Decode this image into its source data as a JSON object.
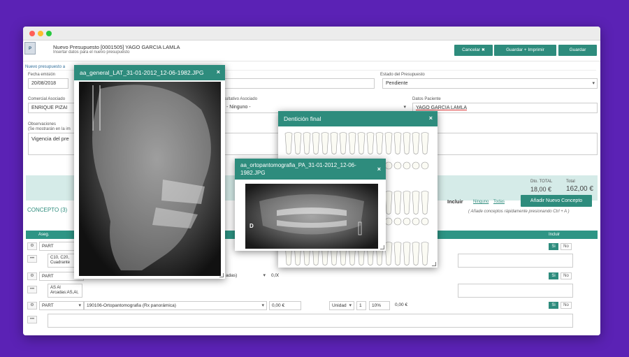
{
  "header": {
    "title": "Nuevo Presupuesto [0001505] YAGO GARCIA LAMLA",
    "subtitle": "Insertar datos para el nuevo presupuesto",
    "logo": "P",
    "cancel_label": "Cancelar",
    "cancel_icon": "✖",
    "save_print_label": "Guardar + Imprimir",
    "save_label": "Guardar"
  },
  "form": {
    "breadcrumb": "Nuevo presupuesto a",
    "fecha_label": "Fecha emisión",
    "fecha_value": "20/08/2018",
    "estado_label": "Estado del Presupuesto",
    "estado_value": "Pendiente",
    "comercial_label": "Comercial Asociado",
    "comercial_value": "ENRIQUE PIZAI",
    "facultativo_label": "cultativo Asociado",
    "facultativo_value": "- Ninguno -",
    "paciente_label": "Datos Paciente",
    "paciente_value": "YAGO GARCIA LAMLA",
    "obs_label": "Observaciones",
    "obs_sub": "(Se mostrarán en la im",
    "obs_value": "Vigencia del pre"
  },
  "totals": {
    "dto_label": "Dto. TOTAL",
    "dto_value": "18,00 €",
    "total_label": "Total",
    "total_value": "162,00 €"
  },
  "concepts": {
    "title": "CONCEPTO (3)",
    "incluir_label": "Incluir",
    "ninguno": "Ninguno",
    "todas": "Todas",
    "add_label": "Añadir Nuevo Concepto",
    "hint": "( Añade conceptos rápidamente presionando Ctrl + A )",
    "col_aseg": "Aseg.",
    "col_incluir": "Incluir",
    "rows": [
      {
        "type": "PART",
        "concept": "",
        "price": "",
        "notes": "C10, C20,\nCuadrante",
        "si": "Si",
        "no": "No"
      },
      {
        "type": "PART",
        "concept": "adas)",
        "price": "0,00",
        "notes": "AS Al\nArcadas:AS,Al,",
        "si": "Si",
        "no": "No"
      },
      {
        "type": "PART",
        "concept": "190106-Ortopantomografia (Rx panorámica)",
        "price": "0,00 €",
        "unit": "Unidad",
        "qty": "1",
        "dto": "10%",
        "total": "0,00 €",
        "notes": "",
        "si": "Si",
        "no": "No"
      }
    ]
  },
  "modals": {
    "lat": {
      "title": "aa_general_LAT_31-01-2012_12-06-1982.JPG",
      "close": "×"
    },
    "dent": {
      "title": "Dentición final",
      "close": "×"
    },
    "orto": {
      "title": "aa_ortopantomografia_PA_31-01-2012_12-06-1982.JPG",
      "close": "×",
      "marker": "D"
    }
  },
  "icons": {
    "settings": "gear-icon",
    "more": "ellipsis-icon",
    "close": "close-icon"
  },
  "colors": {
    "accent": "#2e8c7d",
    "background": "#5b22b5",
    "header_bar": "#2e9585"
  }
}
